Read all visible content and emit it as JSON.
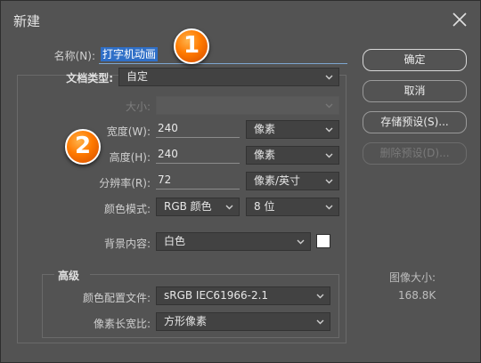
{
  "dialog": {
    "title": "新建"
  },
  "name": {
    "label": "名称(N):",
    "value": "打字机动画"
  },
  "doc_type": {
    "label": "文档类型:",
    "value": "自定"
  },
  "size": {
    "label": "大小:",
    "value": ""
  },
  "width": {
    "label": "宽度(W):",
    "value": "240",
    "unit": "像素"
  },
  "height": {
    "label": "高度(H):",
    "value": "240",
    "unit": "像素"
  },
  "resolution": {
    "label": "分辨率(R):",
    "value": "72",
    "unit": "像素/英寸"
  },
  "color_mode": {
    "label": "颜色模式:",
    "mode": "RGB 颜色",
    "depth": "8 位"
  },
  "background": {
    "label": "背景内容:",
    "value": "白色",
    "swatch_color": "#ffffff"
  },
  "advanced": {
    "title": "高级",
    "profile_label": "颜色配置文件:",
    "profile_value": "sRGB IEC61966-2.1",
    "aspect_label": "像素长宽比:",
    "aspect_value": "方形像素"
  },
  "buttons": {
    "ok": "确定",
    "cancel": "取消",
    "save_preset": "存储预设(S)...",
    "delete_preset": "删除预设(D)..."
  },
  "image_size": {
    "label": "图像大小:",
    "value": "168.8K"
  },
  "annotations": {
    "badge1": "1",
    "badge2": "2"
  },
  "colors": {
    "background": "#535353",
    "selection": "#2f6fc7",
    "badge": "#ff7a00"
  }
}
